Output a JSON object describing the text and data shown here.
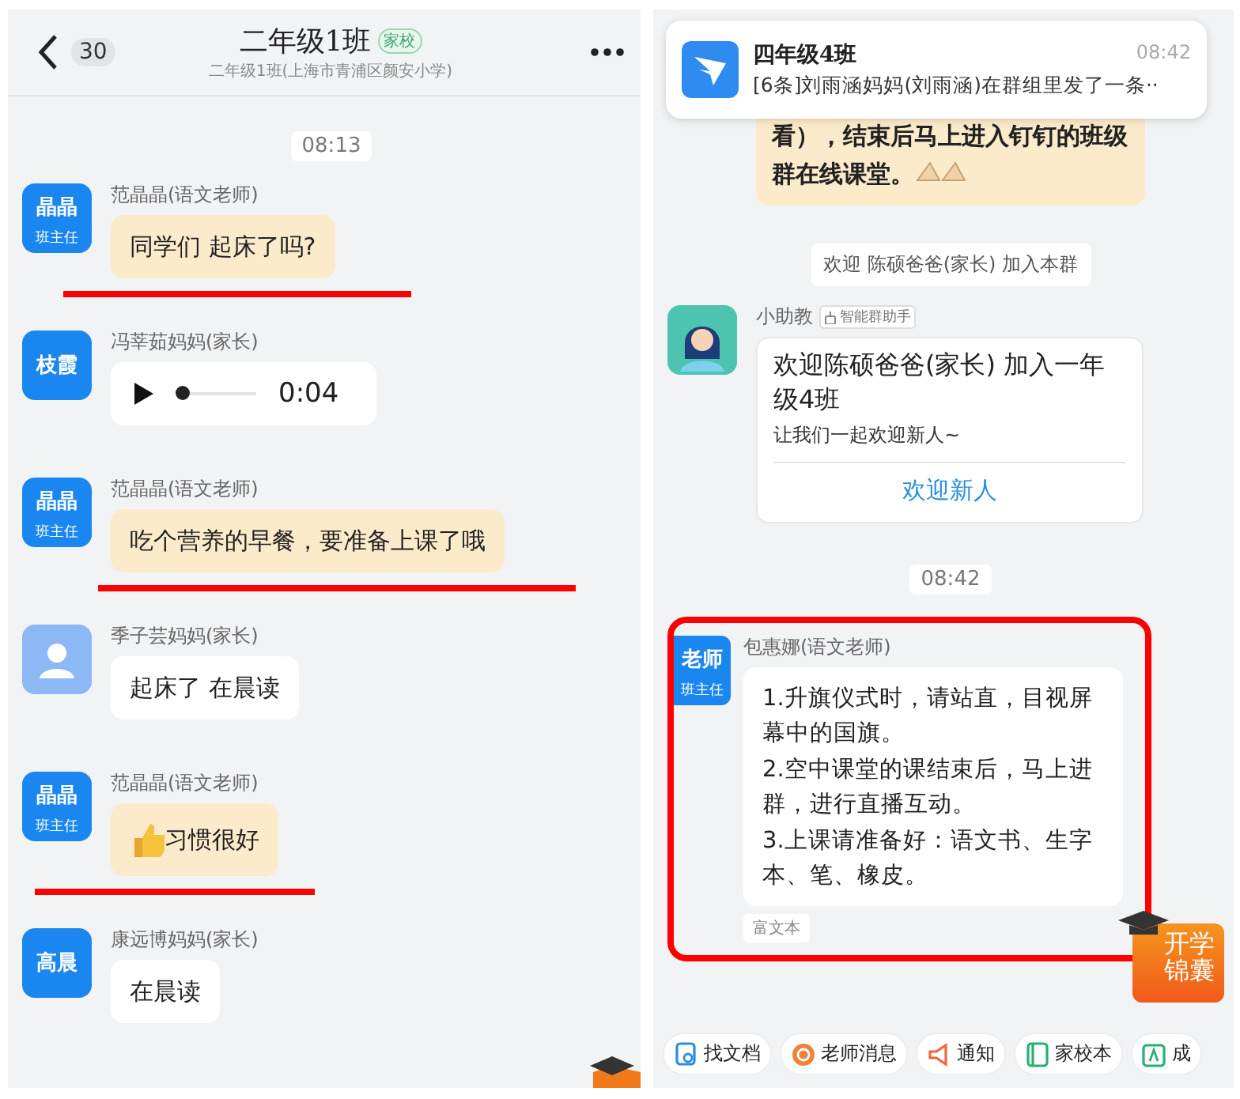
{
  "left_chat": {
    "back_count": "30",
    "title": "二年级1班",
    "tag": "家校",
    "subtitle": "二年级1班(上海市青浦区颜安小学)",
    "messages": [
      {
        "kind": "time",
        "text": "08:13"
      },
      {
        "kind": "text",
        "avatar": {
          "kind": "initials",
          "name": "晶晶",
          "role": "班主任"
        },
        "sender": "范晶晶(语文老师)",
        "text": "同学们 起床了吗?",
        "highlighted": true,
        "underlined": true
      },
      {
        "kind": "voice",
        "avatar": {
          "kind": "initials",
          "name": "枝霞"
        },
        "sender": "冯莘茹妈妈(家长)",
        "duration": "0:04",
        "level": 0.05,
        "highlighted": false,
        "underlined": false
      },
      {
        "kind": "text",
        "avatar": {
          "kind": "initials",
          "name": "晶晶",
          "role": "班主任"
        },
        "sender": "范晶晶(语文老师)",
        "text": "吃个营养的早餐，要准备上课了哦",
        "highlighted": true,
        "underlined": true
      },
      {
        "kind": "text",
        "avatar": {
          "kind": "person"
        },
        "sender": "季子芸妈妈(家长)",
        "text": "起床了 在晨读",
        "highlighted": false,
        "underlined": false
      },
      {
        "kind": "thumbs",
        "avatar": {
          "kind": "initials",
          "name": "晶晶",
          "role": "班主任"
        },
        "sender": "范晶晶(语文老师)",
        "text": "习惯很好",
        "highlighted": true,
        "underlined": true
      },
      {
        "kind": "text",
        "avatar": {
          "kind": "initials",
          "name": "高晨"
        },
        "sender": "康远博妈妈(家长)",
        "text": "在晨读",
        "highlighted": false,
        "underlined": false
      }
    ]
  },
  "right_chat": {
    "notification": {
      "title": "四年级4班",
      "time": "08:42",
      "text": "[6条]刘雨涵妈妈(刘雨涵)在群组里发了一条··"
    },
    "messages": [
      {
        "kind": "partial",
        "text": "看），结束后马上进入钉钉的班级群在线课堂。",
        "highlighted": true
      },
      {
        "kind": "notice",
        "text": "欢迎 陈硕爸爸(家长) 加入本群"
      },
      {
        "kind": "card",
        "avatar": {
          "kind": "bot"
        },
        "sender": "小助教",
        "sender_tag": "智能群助手",
        "title": "欢迎陈硕爸爸(家长) 加入一年级4班",
        "subtitle": "让我们一起欢迎新人~",
        "action": "欢迎新人"
      },
      {
        "kind": "time",
        "text": "08:42"
      },
      {
        "kind": "text",
        "avatar": {
          "kind": "initials",
          "name": "老师",
          "role": "班主任"
        },
        "sender": "包惠娜(语文老师)",
        "text": "1.升旗仪式时，请站直，目视屏幕中的国旗。\n2.空中课堂的课结束后，马上进群，进行直播互动。\n3.上课请准备好：语文书、生字本、笔、橡皮。",
        "highlighted": false,
        "framed": true,
        "footer": "富文本"
      }
    ],
    "float_badge": "开学锦囊",
    "toolbar": [
      {
        "kind": "doc",
        "label": "找文档"
      },
      {
        "kind": "teacher",
        "label": "老师消息"
      },
      {
        "kind": "notice",
        "label": "通知"
      },
      {
        "kind": "book",
        "label": "家校本"
      },
      {
        "kind": "score",
        "label": "成"
      }
    ]
  }
}
